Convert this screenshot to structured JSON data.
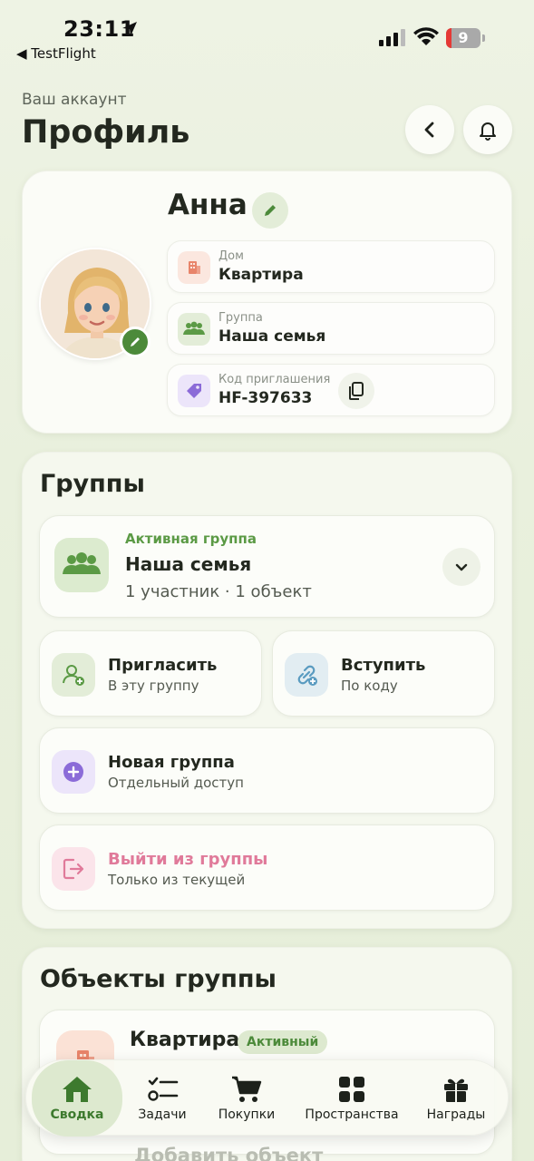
{
  "status_bar": {
    "time": "23:11",
    "back_app": "◀ TestFlight",
    "battery": "9"
  },
  "header": {
    "subtitle": "Ваш аккаунт",
    "title": "Профиль"
  },
  "profile": {
    "name": "Анна",
    "rows": [
      {
        "label": "Дом",
        "value": "Квартира",
        "icon": "building-icon",
        "color": "#e8846a"
      },
      {
        "label": "Группа",
        "value": "Наша семья",
        "icon": "people-icon",
        "color": "#5b9a45"
      },
      {
        "label": "Код приглашения",
        "value": "HF-397633",
        "icon": "tag-icon",
        "color": "#8b6bd8"
      }
    ]
  },
  "groups": {
    "title": "Группы",
    "active": {
      "tag": "Активная группа",
      "name": "Наша семья",
      "meta": "1 участник · 1 объект"
    },
    "invite": {
      "title": "Пригласить",
      "sub": "В эту группу"
    },
    "join": {
      "title": "Вступить",
      "sub": "По коду"
    },
    "new_group": {
      "title": "Новая группа",
      "sub": "Отдельный доступ"
    },
    "leave": {
      "title": "Выйти из группы",
      "sub": "Только из текущей",
      "color": "#e07a9a"
    }
  },
  "objects": {
    "title": "Объекты группы",
    "item": {
      "name": "Квартира",
      "badge": "Активный"
    },
    "add_label": "Добавить объект"
  },
  "tabs": [
    {
      "label": "Сводка",
      "icon": "home-icon",
      "active": true
    },
    {
      "label": "Задачи",
      "icon": "checklist-icon"
    },
    {
      "label": "Покупки",
      "icon": "cart-icon"
    },
    {
      "label": "Пространства",
      "icon": "grid-icon"
    },
    {
      "label": "Награды",
      "icon": "gift-icon"
    }
  ],
  "colors": {
    "accent": "#4c8a3a",
    "background": "#eef3e4",
    "danger_pink": "#e07a9a"
  }
}
